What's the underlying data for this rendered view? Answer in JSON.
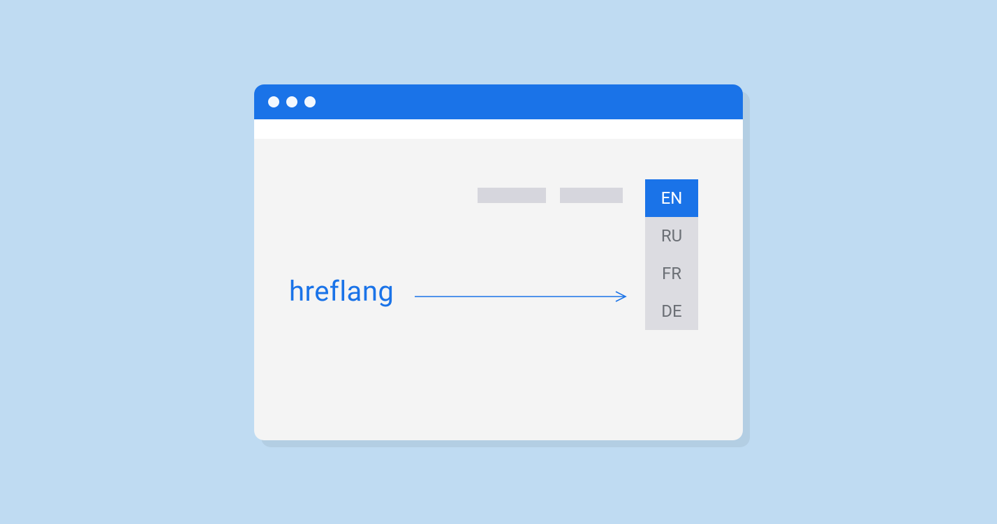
{
  "colors": {
    "background": "#bfdbf2",
    "accent": "#1a73e8",
    "window_bg": "#f4f4f4",
    "placeholder": "#d6d6dd",
    "dropdown_bg": "#dcdce1",
    "dropdown_text": "#6b6f75"
  },
  "concept_label": "hreflang",
  "languages": {
    "selected": "EN",
    "options": [
      "EN",
      "RU",
      "FR",
      "DE"
    ]
  }
}
